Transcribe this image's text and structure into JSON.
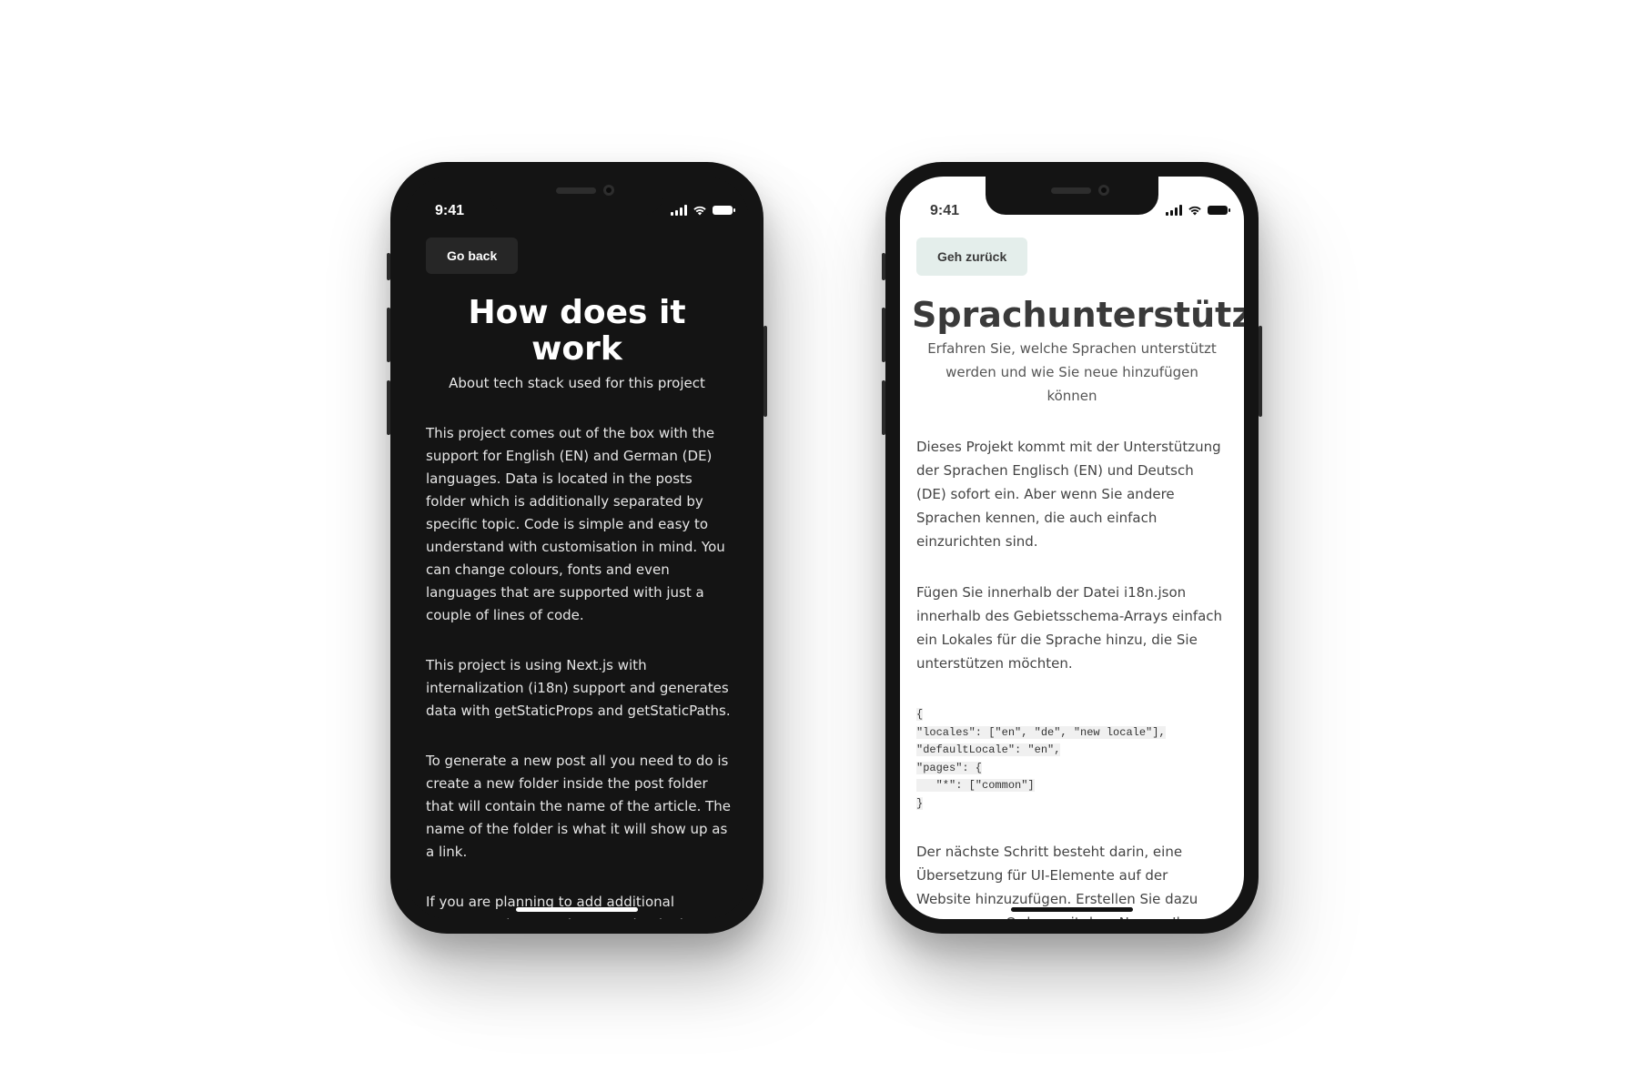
{
  "left_phone": {
    "time": "9:41",
    "back_label": "Go back",
    "title": "How does it work",
    "subtitle": "About tech stack used for this project",
    "paragraphs": [
      "This project comes out of the box with the support for English (EN) and German (DE) languages. Data is located in the posts folder which is additionally separated by specific topic. Code is simple and easy to understand with customisation in mind. You can change colours, fonts and even languages that are supported with just a couple of lines of code.",
      "This project is using Next.js with internalization (i18n) support and generates data with getStaticProps and getStaticPaths.",
      "To generate a new post all you need to do is create a new folder inside the post folder that will contain the name of the article. The name of the folder is what it will show up as a link.",
      "If you are planning to add additional languages that are also very simple, just add that language inside the i18n.json file in the locales array. Inside the locales folder, you are also going to"
    ]
  },
  "right_phone": {
    "time": "9:41",
    "back_label": "Geh zurück",
    "title": "Sprachunterstützung",
    "subtitle": "Erfahren Sie, welche Sprachen unterstützt werden und wie Sie neue hinzufügen können",
    "paragraphs": [
      "Dieses Projekt kommt mit der Unterstützung der Sprachen Englisch (EN) und Deutsch (DE) sofort ein. Aber wenn Sie andere Sprachen kennen, die auch einfach einzurichten sind.",
      "Fügen Sie innerhalb der Datei i18n.json innerhalb des Gebietsschema-Arrays einfach ein Lokales für die Sprache hinzu, die Sie unterstützen möchten.",
      "Der nächste Schritt besteht darin, eine Übersetzung für UI-Elemente auf der Website hinzuzufügen. Erstellen Sie dazu einen neuen Ordner mit dem Namen Ihres Gebietsschemas,"
    ],
    "code_lines": [
      "{",
      "\"locales\": [\"en\", \"de\", \"new locale\"],",
      "\"defaultLocale\": \"en\",",
      "\"pages\": {",
      "   \"*\": [\"common\"]",
      "}"
    ]
  },
  "colors": {
    "dark_screen": "#141414",
    "light_screen": "#ffffff",
    "dark_button": "#262626",
    "light_button": "#e4eeeb"
  }
}
